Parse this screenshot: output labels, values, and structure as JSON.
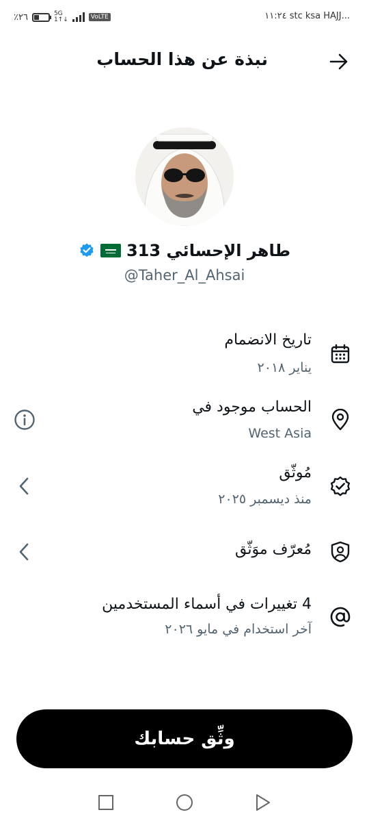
{
  "status_bar": {
    "battery": "٪٢٦",
    "network": "5G",
    "network_sub": "1↑↓",
    "volte": "VoLTE",
    "carrier_time": "١١:٢٤ stc ksa HAJJ..."
  },
  "header": {
    "title": "نبذة عن هذا الحساب",
    "back_icon": "arrow-right-icon"
  },
  "profile": {
    "display_name": "طاهر الإحسائي 313",
    "handle": "@Taher_Al_Ahsai",
    "flag": "saudi-flag-emoji",
    "verified_color": "#1d9bf0"
  },
  "rows": [
    {
      "icon": "calendar-icon",
      "primary": "تاريخ الانضمام",
      "secondary": "يناير ٢٠١٨"
    },
    {
      "icon": "location-pin-icon",
      "primary": "الحساب موجود في",
      "secondary": "West Asia",
      "action_icon": "info-icon"
    },
    {
      "icon": "verified-badge-icon",
      "primary": "مُوثّق",
      "secondary": "منذ ديسمبر ٢٠٢٥",
      "action_icon": "chevron-left-icon"
    },
    {
      "icon": "shield-person-icon",
      "primary": "مُعرّف موَثّق",
      "action_icon": "chevron-left-icon"
    },
    {
      "icon": "at-sign-icon",
      "primary": "4 تغييرات في أسماء المستخدمين",
      "secondary": "آخر استخدام في مايو ٢٠٢٦"
    }
  ],
  "cta": {
    "label": "وثِّق حسابك"
  },
  "nav": {
    "recents": "square-icon",
    "home": "circle-icon",
    "back": "triangle-icon"
  }
}
